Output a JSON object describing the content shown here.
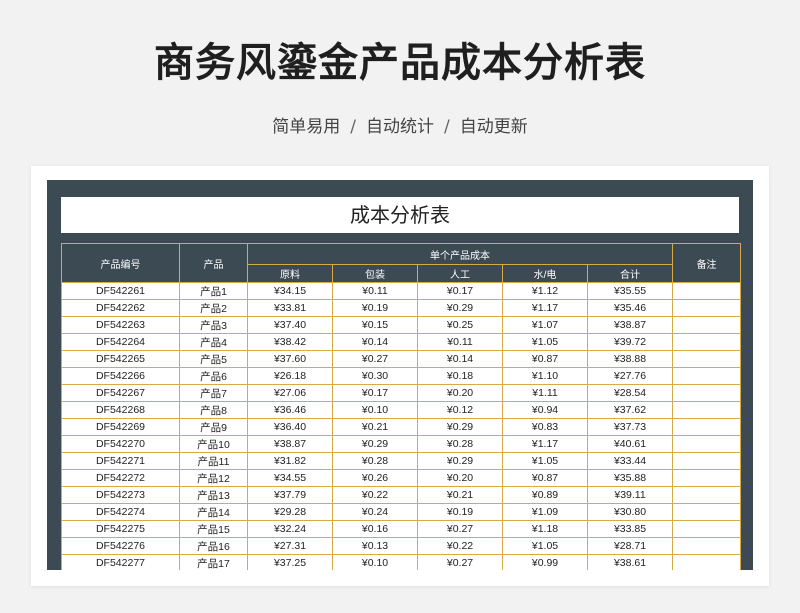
{
  "header": {
    "title": "商务风鎏金产品成本分析表",
    "features": [
      "简单易用",
      "自动统计",
      "自动更新"
    ],
    "separator": "/"
  },
  "sheet": {
    "title": "成本分析表",
    "columns": {
      "code": "产品编号",
      "product": "产品",
      "group": "单个产品成本",
      "material": "原料",
      "packaging": "包装",
      "labor": "人工",
      "utilities": "水/电",
      "total": "合计",
      "notes": "备注"
    },
    "rows": [
      {
        "code": "DF542261",
        "product": "产品1",
        "material": "¥34.15",
        "packaging": "¥0.11",
        "labor": "¥0.17",
        "utilities": "¥1.12",
        "total": "¥35.55",
        "notes": ""
      },
      {
        "code": "DF542262",
        "product": "产品2",
        "material": "¥33.81",
        "packaging": "¥0.19",
        "labor": "¥0.29",
        "utilities": "¥1.17",
        "total": "¥35.46",
        "notes": ""
      },
      {
        "code": "DF542263",
        "product": "产品3",
        "material": "¥37.40",
        "packaging": "¥0.15",
        "labor": "¥0.25",
        "utilities": "¥1.07",
        "total": "¥38.87",
        "notes": ""
      },
      {
        "code": "DF542264",
        "product": "产品4",
        "material": "¥38.42",
        "packaging": "¥0.14",
        "labor": "¥0.11",
        "utilities": "¥1.05",
        "total": "¥39.72",
        "notes": ""
      },
      {
        "code": "DF542265",
        "product": "产品5",
        "material": "¥37.60",
        "packaging": "¥0.27",
        "labor": "¥0.14",
        "utilities": "¥0.87",
        "total": "¥38.88",
        "notes": ""
      },
      {
        "code": "DF542266",
        "product": "产品6",
        "material": "¥26.18",
        "packaging": "¥0.30",
        "labor": "¥0.18",
        "utilities": "¥1.10",
        "total": "¥27.76",
        "notes": ""
      },
      {
        "code": "DF542267",
        "product": "产品7",
        "material": "¥27.06",
        "packaging": "¥0.17",
        "labor": "¥0.20",
        "utilities": "¥1.11",
        "total": "¥28.54",
        "notes": ""
      },
      {
        "code": "DF542268",
        "product": "产品8",
        "material": "¥36.46",
        "packaging": "¥0.10",
        "labor": "¥0.12",
        "utilities": "¥0.94",
        "total": "¥37.62",
        "notes": ""
      },
      {
        "code": "DF542269",
        "product": "产品9",
        "material": "¥36.40",
        "packaging": "¥0.21",
        "labor": "¥0.29",
        "utilities": "¥0.83",
        "total": "¥37.73",
        "notes": ""
      },
      {
        "code": "DF542270",
        "product": "产品10",
        "material": "¥38.87",
        "packaging": "¥0.29",
        "labor": "¥0.28",
        "utilities": "¥1.17",
        "total": "¥40.61",
        "notes": ""
      },
      {
        "code": "DF542271",
        "product": "产品11",
        "material": "¥31.82",
        "packaging": "¥0.28",
        "labor": "¥0.29",
        "utilities": "¥1.05",
        "total": "¥33.44",
        "notes": ""
      },
      {
        "code": "DF542272",
        "product": "产品12",
        "material": "¥34.55",
        "packaging": "¥0.26",
        "labor": "¥0.20",
        "utilities": "¥0.87",
        "total": "¥35.88",
        "notes": ""
      },
      {
        "code": "DF542273",
        "product": "产品13",
        "material": "¥37.79",
        "packaging": "¥0.22",
        "labor": "¥0.21",
        "utilities": "¥0.89",
        "total": "¥39.11",
        "notes": ""
      },
      {
        "code": "DF542274",
        "product": "产品14",
        "material": "¥29.28",
        "packaging": "¥0.24",
        "labor": "¥0.19",
        "utilities": "¥1.09",
        "total": "¥30.80",
        "notes": ""
      },
      {
        "code": "DF542275",
        "product": "产品15",
        "material": "¥32.24",
        "packaging": "¥0.16",
        "labor": "¥0.27",
        "utilities": "¥1.18",
        "total": "¥33.85",
        "notes": ""
      },
      {
        "code": "DF542276",
        "product": "产品16",
        "material": "¥27.31",
        "packaging": "¥0.13",
        "labor": "¥0.22",
        "utilities": "¥1.05",
        "total": "¥28.71",
        "notes": ""
      },
      {
        "code": "DF542277",
        "product": "产品17",
        "material": "¥37.25",
        "packaging": "¥0.10",
        "labor": "¥0.27",
        "utilities": "¥0.99",
        "total": "¥38.61",
        "notes": ""
      }
    ]
  }
}
